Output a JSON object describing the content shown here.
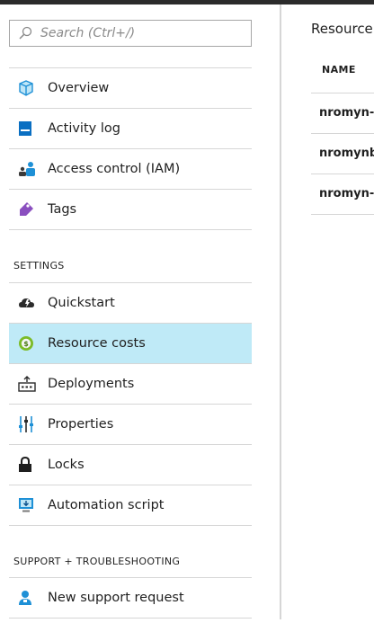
{
  "search": {
    "placeholder": "Search (Ctrl+/)"
  },
  "nav": {
    "overview": "Overview",
    "activity_log": "Activity log",
    "access_control": "Access control (IAM)",
    "tags": "Tags"
  },
  "settings": {
    "heading": "SETTINGS",
    "quickstart": "Quickstart",
    "resource_costs": "Resource costs",
    "deployments": "Deployments",
    "properties": "Properties",
    "locks": "Locks",
    "automation_script": "Automation script"
  },
  "support": {
    "heading": "SUPPORT + TROUBLESHOOTING",
    "new_request": "New support request"
  },
  "resources": {
    "title": "Resource",
    "column_name": "NAME",
    "rows": [
      "nromyn-",
      "nromynb",
      "nromyn-"
    ]
  },
  "colors": {
    "selected": "#bfeaf7",
    "divider": "#d6d6d6",
    "accent": "#0078d7"
  },
  "selected_item": "resource_costs"
}
